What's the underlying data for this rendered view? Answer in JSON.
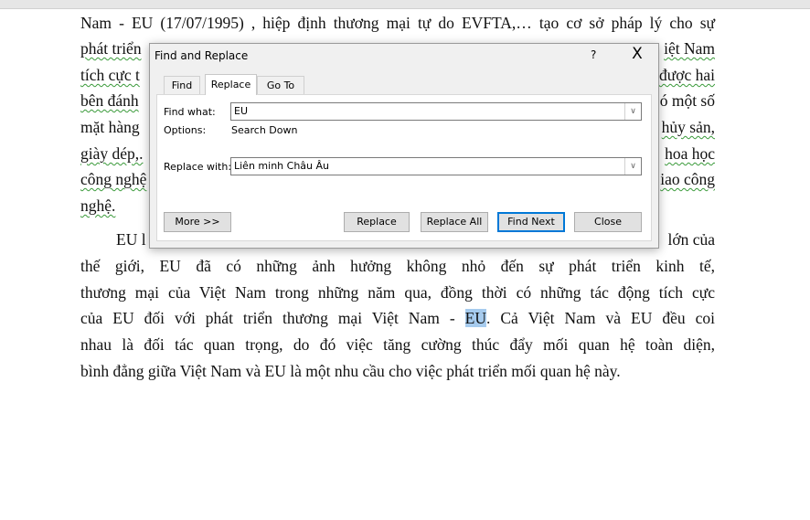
{
  "document": {
    "lines": [
      {
        "full": "Nam - EU (17/07/1995) , hiệp định thương mại tự do EVFTA,… tạo cơ sở pháp lý cho sự"
      },
      {
        "left": "phát triển",
        "right": "iệt Nam"
      },
      {
        "left": "tích cực t",
        "right": "được hai"
      },
      {
        "left": "bên đánh",
        "right": "ó một số"
      },
      {
        "left": "mặt hàng",
        "right": "hủy sản,"
      },
      {
        "left": "giày dép,.",
        "right": "hoa học"
      },
      {
        "left": "công nghệ",
        "right": "iao công"
      },
      {
        "left": "nghệ."
      },
      {
        "left": "EU l",
        "right": "lớn của"
      },
      {
        "full": "thế giới, EU đã có những ảnh hưởng không nhỏ đến sự phát triển kinh tế,"
      },
      {
        "full": "thương mại của Việt Nam trong những năm qua, đồng thời có những tác động tích cực"
      },
      {
        "before": "của EU đối với phát triển thương mại Việt Nam - ",
        "highlight": "EU",
        "after": ". Cả Việt Nam và EU đều coi"
      },
      {
        "full": "nhau là đối tác quan trọng, do đó việc tăng cường thúc đẩy mối quan hệ toàn diện,"
      },
      {
        "last": "bình đẳng giữa Việt Nam và EU là một nhu cầu cho việc phát triển mối quan hệ này."
      }
    ],
    "highlight_color": "#a6cbee"
  },
  "dialog": {
    "title": "Find and Replace",
    "help": "?",
    "close": "X",
    "tabs": [
      "Find",
      "Replace",
      "Go To"
    ],
    "active_tab": "Replace",
    "find_label": "Find what:",
    "find_value": "EU",
    "options_label": "Options:",
    "options_value": "Search Down",
    "replace_label": "Replace with:",
    "replace_value": "Liên minh Châu Âu",
    "buttons": {
      "more": "More >>",
      "replace": "Replace",
      "replace_all": "Replace All",
      "find_next": "Find Next",
      "close": "Close"
    },
    "accent": "#0078d7"
  }
}
